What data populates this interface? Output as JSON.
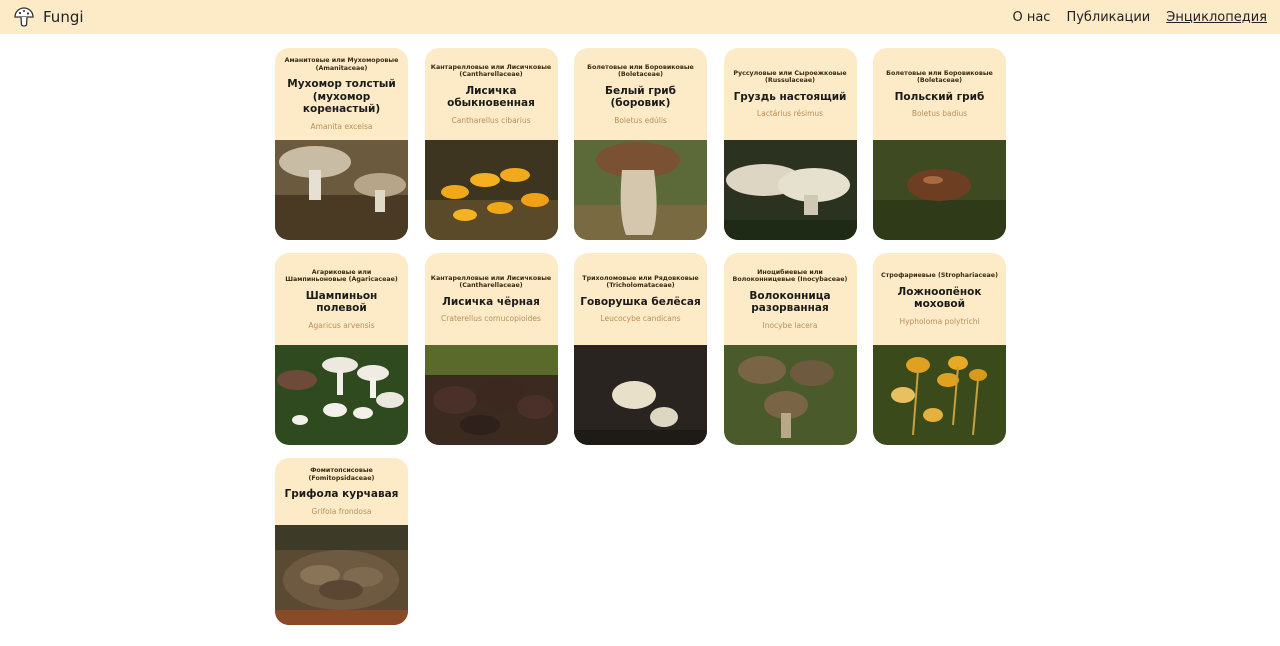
{
  "header": {
    "brand": "Fungi",
    "nav": [
      {
        "label": "О нас"
      },
      {
        "label": "Публикации"
      },
      {
        "label": "Энциклопедия"
      }
    ]
  },
  "cards": [
    {
      "family": "Аманитовые или Мухоморовые (Amanitaceae)",
      "title": "Мухомор толстый (мухомор коренастый)",
      "latin": "Amanita excelsa"
    },
    {
      "family": "Кантарелловые или Лисичковые (Cantharellaceae)",
      "title": "Лисичка обыкновенная",
      "latin": "Cantharellus cibarius"
    },
    {
      "family": "Болетовые или Боровиковые (Boletaceae)",
      "title": "Белый гриб (боровик)",
      "latin": "Boletus edúlis"
    },
    {
      "family": "Руссуловые или Сыроежковые (Russulaceae)",
      "title": "Груздь настоящий",
      "latin": "Lactárius résimus"
    },
    {
      "family": "Болетовые или Боровиковые (Boletaceae)",
      "title": "Польский гриб",
      "latin": "Boletus badius"
    },
    {
      "family": "Агариковые или Шампиньоновые (Agaricaceae)",
      "title": "Шампиньон полевой",
      "latin": "Agaricus arvensis"
    },
    {
      "family": "Кантарелловые или Лисичковые (Cantharellaceae)",
      "title": "Лисичка чёрная",
      "latin": "Craterellus cornucopioides"
    },
    {
      "family": "Трихоломовые или Рядовковые (Tricholomataceae)",
      "title": "Говорушка белёсая",
      "latin": "Leucocybe candicans"
    },
    {
      "family": "Иноцибиевые или Волоконницевые (Inocybaceae)",
      "title": "Волоконница разорванная",
      "latin": "Inocybe lacera"
    },
    {
      "family": "Строфариевые (Strophariaceae)",
      "title": "Ложноопёнок моховой",
      "latin": "Hypholoma polytrichi"
    },
    {
      "family": "Фомитопсисовые (Fomitopsidaceae)",
      "title": "Грифола курчавая",
      "latin": "Grifola frondosa"
    }
  ]
}
